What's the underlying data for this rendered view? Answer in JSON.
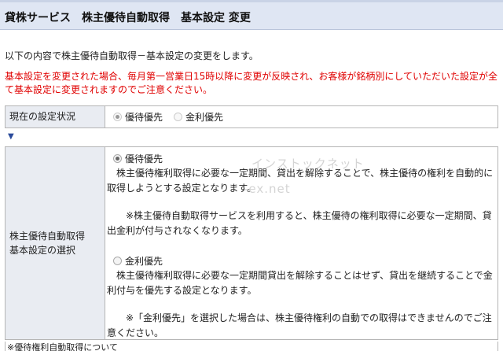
{
  "header": {
    "title": "貸株サービス　株主優待自動取得　基本設定 変更"
  },
  "intro_text": "以下の内容で株主優待自動取得－基本設定の変更をします。",
  "notice_text": "基本設定を変更された場合、毎月第一営業日15時以降に変更が反映され、お客様が銘柄別にしていただいた設定が全て基本設定に変更されますのでご注意ください。",
  "current_status": {
    "label": "現在の設定状況",
    "options": [
      "優待優先",
      "金利優先"
    ],
    "selected": "優待優先"
  },
  "arrow_symbol": "▼",
  "selection": {
    "label_line1": "株主優待自動取得",
    "label_line2": "基本設定の選択",
    "option1": {
      "title": "優待優先",
      "desc": "　株主優待権利取得に必要な一定期間、貸出を解除することで、株主優待の権利を自動的に取得しようとする設定となります。",
      "note": "　　※株主優待自動取得サービスを利用すると、株主優待の権利取得に必要な一定期間、貸出金利が付与されなくなります。"
    },
    "option2": {
      "title": "金利優先",
      "desc": "　株主優待権利取得に必要な一定期間貸出を解除することはせず、貸出を継続することで金利付与を優先する設定となります。",
      "note": "　　※「金利優先」を選択した場合は、株主優待権利の自動での取得はできませんのでご注意ください。"
    },
    "selected": "優待優先"
  },
  "watermark": {
    "line1": "インストックネット",
    "line2": "-ex.net"
  },
  "footer_text": "※優待権利自動取得について"
}
